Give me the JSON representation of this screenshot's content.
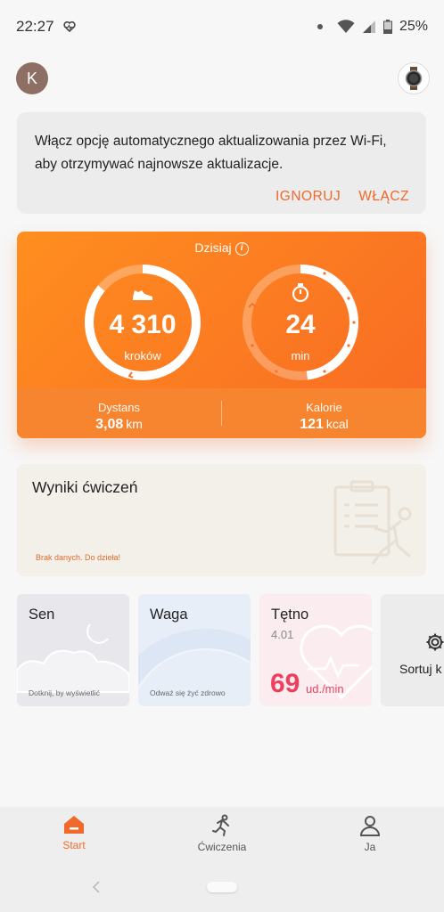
{
  "status": {
    "time": "22:27",
    "battery": "25%"
  },
  "header": {
    "avatar_letter": "K"
  },
  "update_card": {
    "line1": "Włącz opcję automatycznego aktualizowania przez Wi-Fi,",
    "line2": "aby otrzymywać najnowsze aktualizacje.",
    "ignore_label": "IGNORUJ",
    "enable_label": "WŁĄCZ"
  },
  "today": {
    "title": "Dzisiaj",
    "steps_value": "4 310",
    "steps_unit": "kroków",
    "steps_progress": 0.86,
    "minutes_value": "24",
    "minutes_unit": "min",
    "minutes_progress": 0.48,
    "distance_label": "Dystans",
    "distance_value": "3,08",
    "distance_unit": "km",
    "calories_label": "Kalorie",
    "calories_value": "121",
    "calories_unit": "kcal"
  },
  "exercise": {
    "title": "Wyniki ćwiczeń",
    "empty_text": "Brak danych. Do dzieła!"
  },
  "tiles": {
    "sleep": {
      "title": "Sen",
      "hint": "Dotknij, by wyświetlić"
    },
    "weight": {
      "title": "Waga",
      "hint": "Odważ się żyć zdrowo"
    },
    "heart": {
      "title": "Tętno",
      "date": "4.01",
      "value": "69",
      "unit": "ud./min"
    },
    "sort": {
      "label": "Sortuj k"
    }
  },
  "nav": [
    {
      "label": "Start",
      "icon": "home-icon"
    },
    {
      "label": "Ćwiczenia",
      "icon": "running-icon"
    },
    {
      "label": "Ja",
      "icon": "person-icon"
    }
  ],
  "colors": {
    "accent": "#f06a2c",
    "heart": "#ef3e5e"
  }
}
